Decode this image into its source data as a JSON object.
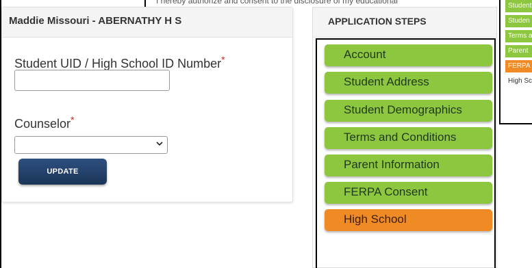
{
  "background": {
    "partial_text": "I hereby authorize and consent to the disclosure of my educational"
  },
  "student_card": {
    "header_title": "Maddie Missouri - ABERNATHY H S",
    "uid_label": "Student UID / High School ID Number",
    "uid_value": "",
    "counselor_label": "Counselor",
    "counselor_value": "",
    "required_mark": "*",
    "update_label": "UPDATE"
  },
  "steps": {
    "title": "APPLICATION STEPS",
    "items": [
      {
        "label": "Account",
        "status": "green"
      },
      {
        "label": "Student Address",
        "status": "green"
      },
      {
        "label": "Student Demographics",
        "status": "green"
      },
      {
        "label": "Terms and Conditions",
        "status": "green"
      },
      {
        "label": "Parent Information",
        "status": "green"
      },
      {
        "label": "FERPA Consent",
        "status": "green"
      },
      {
        "label": "High School",
        "status": "orange"
      }
    ]
  },
  "mini_steps": {
    "items": [
      {
        "label": "Student",
        "status": "green"
      },
      {
        "label": "Studen",
        "status": "green"
      },
      {
        "label": "Terms a",
        "status": "green"
      },
      {
        "label": "Parent",
        "status": "green"
      },
      {
        "label": "FERPA C",
        "status": "orange"
      },
      {
        "label": "High Sc",
        "status": "plain"
      }
    ]
  },
  "colors": {
    "step_green": "#8dc63f",
    "step_orange": "#f08a24",
    "button_blue": "#1b3557",
    "required_red": "#dd2222"
  }
}
